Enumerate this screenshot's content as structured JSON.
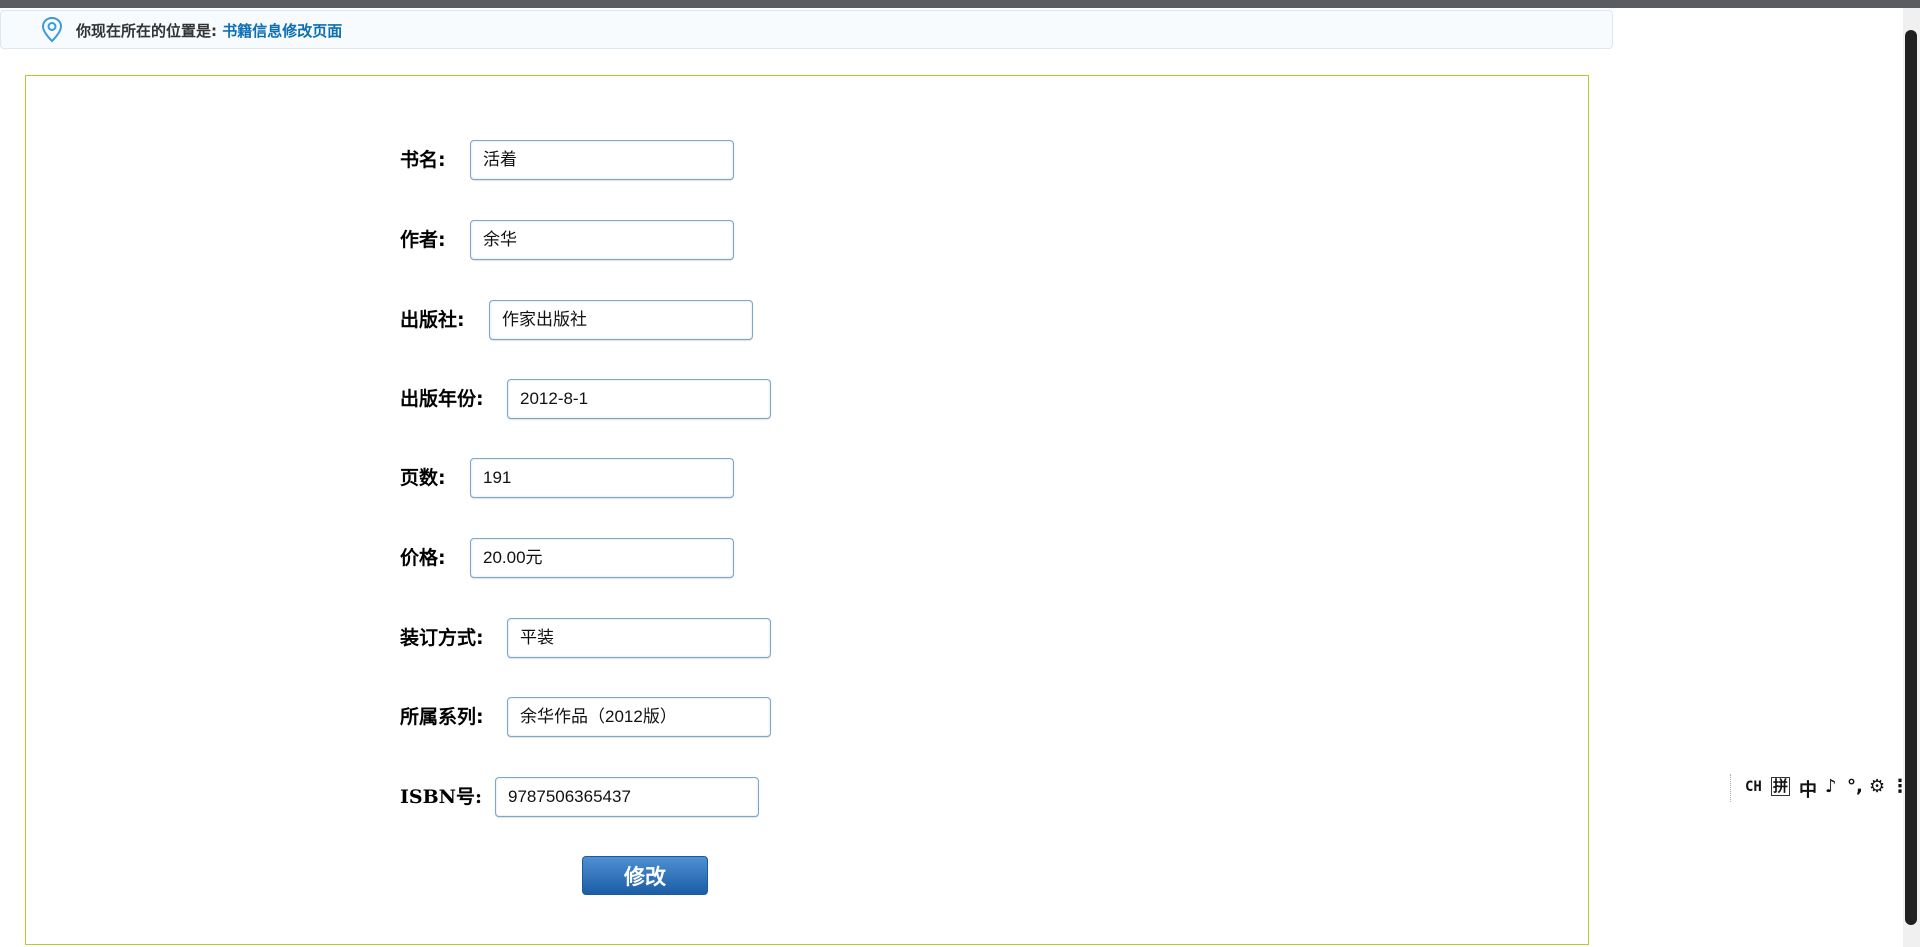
{
  "breadcrumb": {
    "prefix": "你现在所在的位置是:",
    "current": "书籍信息修改页面"
  },
  "form": {
    "fields": [
      {
        "label": "书名:",
        "value": "活着"
      },
      {
        "label": "作者:",
        "value": "余华"
      },
      {
        "label": "出版社:",
        "value": "作家出版社"
      },
      {
        "label": "出版年份:",
        "value": "2012-8-1"
      },
      {
        "label": "页数:",
        "value": "191"
      },
      {
        "label": "价格:",
        "value": "20.00元"
      },
      {
        "label": "装订方式:",
        "value": "平装"
      },
      {
        "label": "所属系列:",
        "value": "余华作品（2012版）"
      },
      {
        "label": "ISBN号:",
        "value": "9787506365437"
      }
    ],
    "submit_label": "修改"
  },
  "ime_toolbar": {
    "items": [
      "CH",
      "拼",
      "中",
      "♪",
      "°,",
      "⚙",
      "⋮"
    ]
  },
  "colors": {
    "panel_border": "#b5cc2a",
    "link": "#0e6fb5",
    "button": "#2a6db8"
  }
}
